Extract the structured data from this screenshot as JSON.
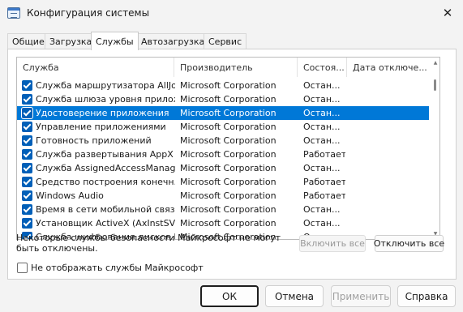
{
  "window": {
    "title": "Конфигурация системы",
    "close_glyph": "✕"
  },
  "tabs": [
    {
      "label": "Общие"
    },
    {
      "label": "Загрузка"
    },
    {
      "label": "Службы"
    },
    {
      "label": "Автозагрузка"
    },
    {
      "label": "Сервис"
    }
  ],
  "active_tab": "Службы",
  "columns": [
    "Служба",
    "Производитель",
    "Состоя...",
    "Дата отключе..."
  ],
  "rows": [
    {
      "name": "Служба маршрутизатора AllJoyn",
      "maker": "Microsoft Corporation",
      "status": "Остан...",
      "checked": true,
      "selected": false
    },
    {
      "name": "Служба шлюза уровня прилож...",
      "maker": "Microsoft Corporation",
      "status": "Остан...",
      "checked": true,
      "selected": false
    },
    {
      "name": "Удостоверение приложения",
      "maker": "Microsoft Corporation",
      "status": "Остан...",
      "checked": true,
      "selected": true
    },
    {
      "name": "Управление приложениями",
      "maker": "Microsoft Corporation",
      "status": "Остан...",
      "checked": true,
      "selected": false
    },
    {
      "name": "Готовность приложений",
      "maker": "Microsoft Corporation",
      "status": "Остан...",
      "checked": true,
      "selected": false
    },
    {
      "name": "Служба развертывания AppX (...",
      "maker": "Microsoft Corporation",
      "status": "Работает",
      "checked": true,
      "selected": false
    },
    {
      "name": "Служба AssignedAccessManager",
      "maker": "Microsoft Corporation",
      "status": "Остан...",
      "checked": true,
      "selected": false
    },
    {
      "name": "Средство построения конечн...",
      "maker": "Microsoft Corporation",
      "status": "Работает",
      "checked": true,
      "selected": false
    },
    {
      "name": "Windows Audio",
      "maker": "Microsoft Corporation",
      "status": "Работает",
      "checked": true,
      "selected": false
    },
    {
      "name": "Время в сети мобильной связи",
      "maker": "Microsoft Corporation",
      "status": "Остан...",
      "checked": true,
      "selected": false
    },
    {
      "name": "Установщик ActiveX (AxInstSV)",
      "maker": "Microsoft Corporation",
      "status": "Остан...",
      "checked": true,
      "selected": false
    },
    {
      "name": "Служба шифрования дисков Bi...",
      "maker": "Microsoft Corporation",
      "status": "Остан...",
      "checked": true,
      "selected": false
    }
  ],
  "note": "Некоторые службы безопасности Майкрософт не могут быть отключены.",
  "buttons": {
    "enable_all": "Включить все",
    "disable_all": "Отключить все",
    "ok": "ОК",
    "cancel": "Отмена",
    "apply": "Применить",
    "help": "Справка"
  },
  "hide_ms_label": "Не отображать службы Майкрософт",
  "colors": {
    "selection": "#0078d7",
    "checkbox": "#005fb8"
  }
}
